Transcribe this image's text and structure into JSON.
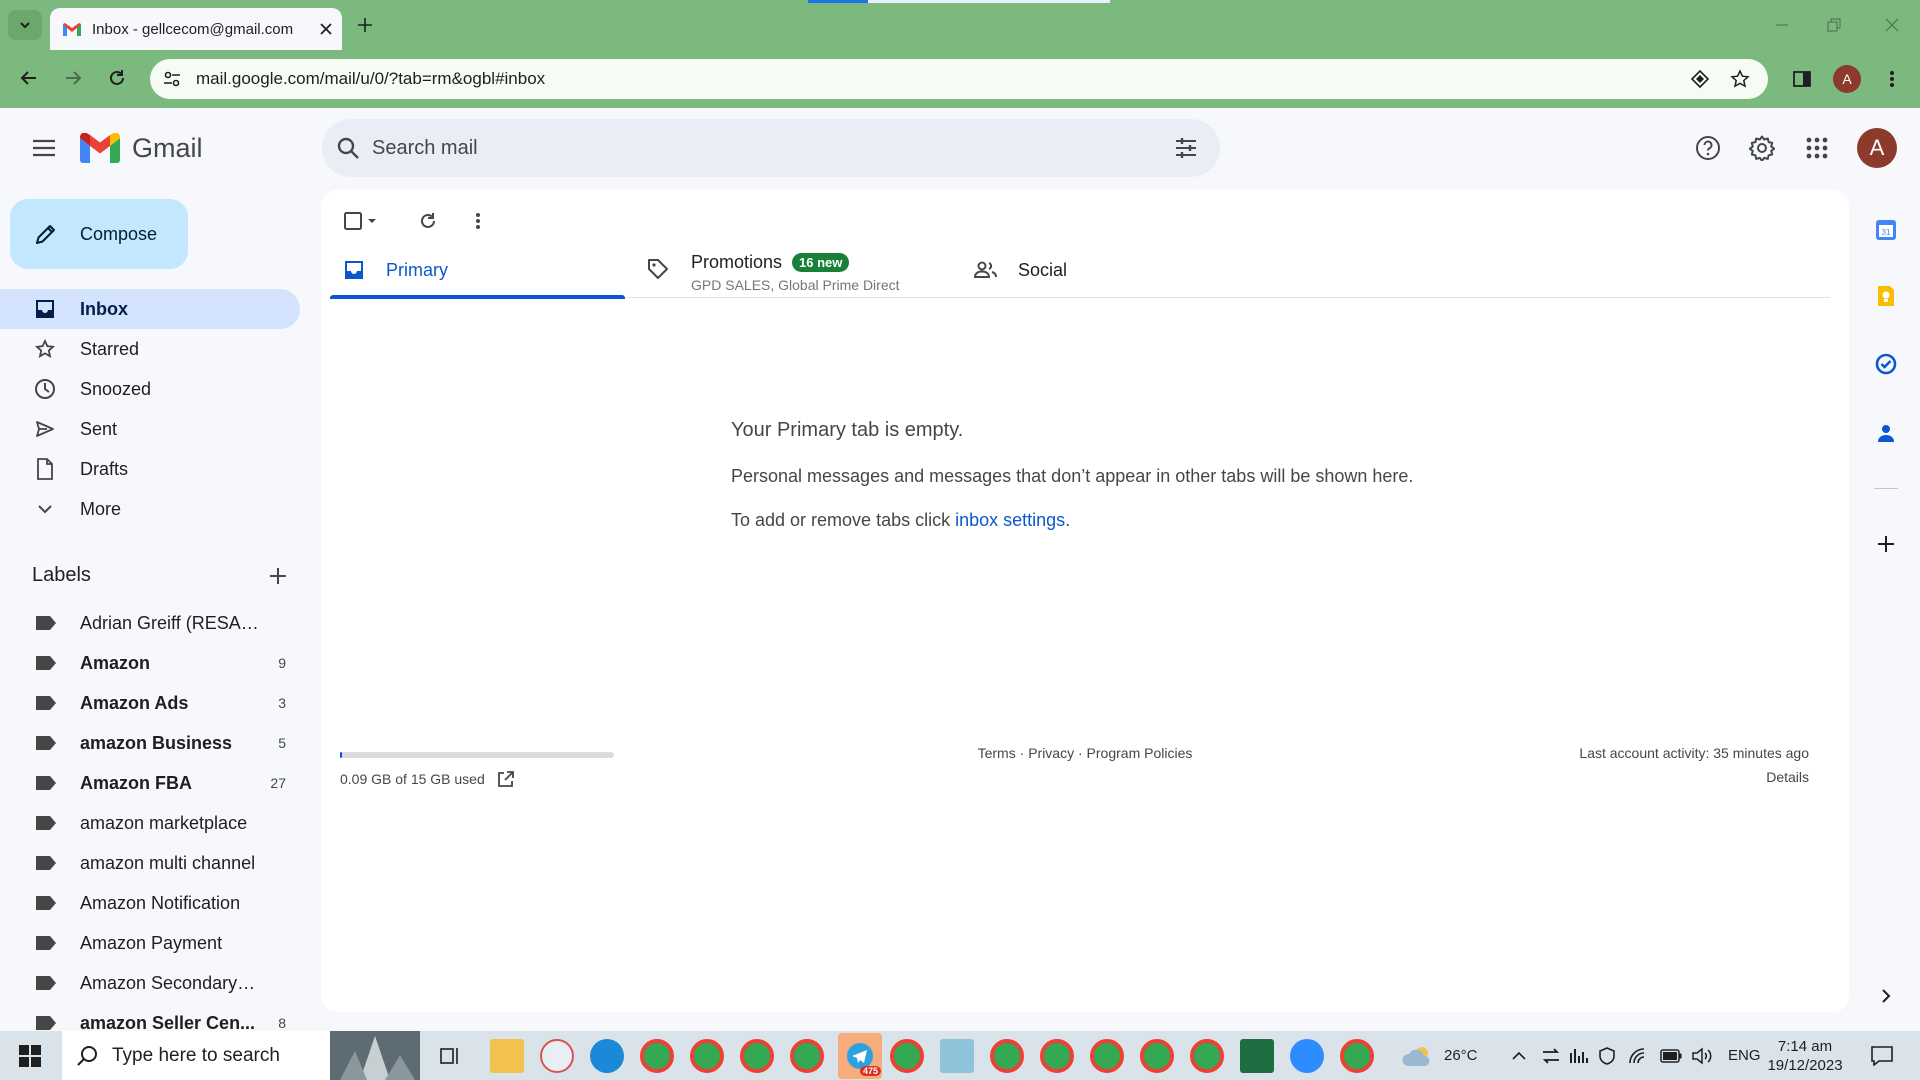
{
  "browser": {
    "tab_title": "Inbox - gellcecom@gmail.com",
    "url": "mail.google.com/mail/u/0/?tab=rm&ogbl#inbox",
    "profile_initial": "A"
  },
  "gmail": {
    "logo_text": "Gmail",
    "search_placeholder": "Search mail",
    "compose_label": "Compose",
    "avatar_initial": "A",
    "nav": [
      {
        "label": "Inbox",
        "icon": "inbox-icon",
        "active": true
      },
      {
        "label": "Starred",
        "icon": "star-icon"
      },
      {
        "label": "Snoozed",
        "icon": "clock-icon"
      },
      {
        "label": "Sent",
        "icon": "send-icon"
      },
      {
        "label": "Drafts",
        "icon": "draft-icon"
      },
      {
        "label": "More",
        "icon": "chevron-down-icon"
      }
    ],
    "labels_heading": "Labels",
    "labels": [
      {
        "name": "Adrian Greiff (RESALE C...",
        "count": "",
        "bold": false
      },
      {
        "name": "Amazon",
        "count": "9",
        "bold": true
      },
      {
        "name": "Amazon Ads",
        "count": "3",
        "bold": true
      },
      {
        "name": "amazon Business",
        "count": "5",
        "bold": true
      },
      {
        "name": "Amazon FBA",
        "count": "27",
        "bold": true
      },
      {
        "name": "amazon marketplace",
        "count": "",
        "bold": false
      },
      {
        "name": "amazon multi channel",
        "count": "",
        "bold": false
      },
      {
        "name": "Amazon Notification",
        "count": "",
        "bold": false
      },
      {
        "name": "Amazon Payment",
        "count": "",
        "bold": false
      },
      {
        "name": "Amazon Secondary Invit...",
        "count": "",
        "bold": false
      },
      {
        "name": "amazon Seller Cen...",
        "count": "8",
        "bold": true
      }
    ],
    "tabs": {
      "primary": "Primary",
      "promotions": "Promotions",
      "promotions_badge": "16 new",
      "promotions_sub": "GPD SALES, Global Prime Direct",
      "social": "Social"
    },
    "empty": {
      "title": "Your Primary tab is empty.",
      "line1": "Personal messages and messages that don’t appear in other tabs will be shown here.",
      "line2_prefix": "To add or remove tabs click ",
      "line2_link": "inbox settings",
      "line2_suffix": "."
    },
    "footer": {
      "storage": "0.09 GB of 15 GB used",
      "storage_fraction": 0.006,
      "terms": "Terms",
      "privacy": "Privacy",
      "policies": "Program Policies",
      "sep": " · ",
      "activity": "Last account activity: 35 minutes ago",
      "details": "Details"
    },
    "side_apps": [
      "calendar-icon",
      "keep-icon",
      "tasks-icon",
      "contacts-icon",
      "add-icon"
    ]
  },
  "taskbar": {
    "search_placeholder": "Type here to search",
    "telegram_badge": "475",
    "weather": "26°C",
    "language": "ENG",
    "time": "7:14 am",
    "date": "19/12/2023"
  },
  "colors": {
    "chrome_frame": "#7cb97e",
    "compose_bg": "#c2e7ff",
    "nav_active": "#d3e3fd",
    "primary_blue": "#0b57d0",
    "badge_green": "#188038"
  }
}
